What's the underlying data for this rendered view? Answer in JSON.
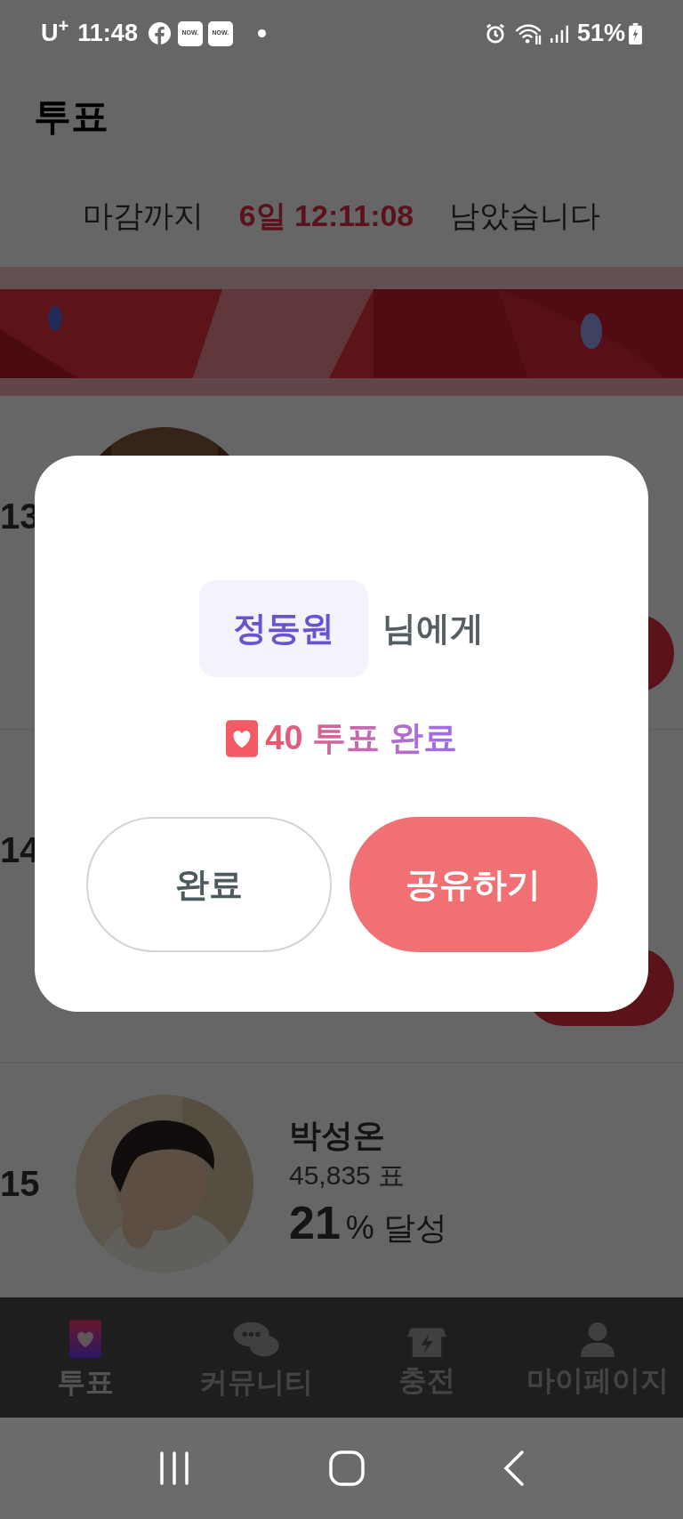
{
  "status_bar": {
    "carrier": "U$^{+}$",
    "time": "11:48",
    "app_badges": [
      "NOW.",
      "NOW."
    ],
    "battery": "51%"
  },
  "header": {
    "title": "투표"
  },
  "countdown": {
    "prefix": "마감까지",
    "remaining": "6일 12:11:08",
    "suffix": "남았습니다"
  },
  "candidates": [
    {
      "rank": "13"
    },
    {
      "rank": "14"
    },
    {
      "rank": "15",
      "name": "박성온",
      "votes": "45,835 표",
      "percent": "21",
      "percent_suffix": "% 달성"
    }
  ],
  "dialog": {
    "recipient": "정동원",
    "recipient_suffix": "님에게",
    "result": "40 투표 완료",
    "buttons": [
      {
        "label": "완료",
        "kind": "secondary"
      },
      {
        "label": "공유하기",
        "kind": "primary"
      }
    ]
  },
  "bottom_nav": [
    {
      "label": "투표",
      "selected": true
    },
    {
      "label": "커뮤니티",
      "selected": false
    },
    {
      "label": "충전",
      "selected": false
    },
    {
      "label": "마이페이지",
      "selected": false
    }
  ]
}
